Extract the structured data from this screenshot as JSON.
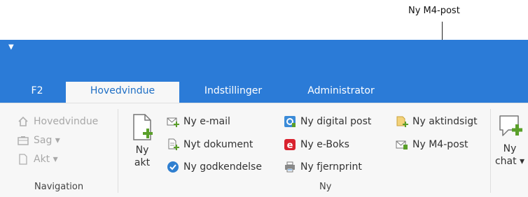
{
  "annotation": {
    "label": "Ny M4-post"
  },
  "tabs": [
    {
      "label": "F2"
    },
    {
      "label": "Hovedvindue"
    },
    {
      "label": "Indstillinger"
    },
    {
      "label": "Administrator"
    }
  ],
  "navigation": {
    "items": [
      {
        "label": "Hovedvindue",
        "icon": "home-icon"
      },
      {
        "label": "Sag ▾",
        "icon": "case-icon"
      },
      {
        "label": "Akt ▾",
        "icon": "document-icon"
      }
    ],
    "group_label": "Navigation"
  },
  "ny": {
    "big_button": {
      "line1": "Ny",
      "line2": "akt"
    },
    "items": [
      {
        "label": "Ny e-mail",
        "icon": "email-plus-icon"
      },
      {
        "label": "Nyt dokument",
        "icon": "document-plus-icon"
      },
      {
        "label": "Ny godkendelse",
        "icon": "checkmark-circle-icon"
      },
      {
        "label": "Ny digital post",
        "icon": "digital-post-icon"
      },
      {
        "label": "Ny e-Boks",
        "icon": "eboks-icon"
      },
      {
        "label": "Ny fjernprint",
        "icon": "remote-print-icon"
      },
      {
        "label": "Ny aktindsigt",
        "icon": "access-plus-icon"
      },
      {
        "label": "Ny M4-post",
        "icon": "m4-mail-icon"
      }
    ],
    "group_label": "Ny"
  },
  "chat": {
    "line1": "Ny",
    "line2": "chat ▾",
    "icon": "chat-plus-icon"
  },
  "colors": {
    "titlebar": "#2b7bd7",
    "active_tab_text": "#1f6fc5",
    "ribbon_bg": "#f7f7f7",
    "accent_green": "#5a9f2a"
  }
}
